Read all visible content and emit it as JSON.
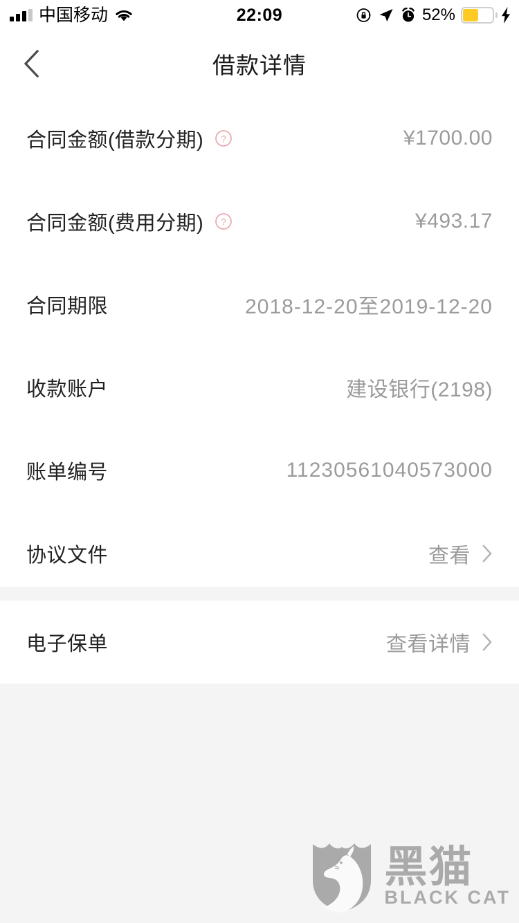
{
  "status_bar": {
    "carrier": "中国移动",
    "time": "22:09",
    "battery_percent": "52%",
    "icons": [
      "signal-bars-icon",
      "wifi-icon",
      "rotation-lock-icon",
      "location-arrow-icon",
      "alarm-clock-icon",
      "battery-icon",
      "charging-bolt-icon"
    ]
  },
  "nav": {
    "back_icon": "chevron-left-icon",
    "title": "借款详情"
  },
  "sections": [
    {
      "rows": [
        {
          "label": "合同金额(借款分期)",
          "help": true,
          "value": "¥1700.00",
          "chevron": false
        },
        {
          "label": "合同金额(费用分期)",
          "help": true,
          "value": "¥493.17",
          "chevron": false
        },
        {
          "label": "合同期限",
          "help": false,
          "value": "2018-12-20至2019-12-20",
          "chevron": false
        },
        {
          "label": "收款账户",
          "help": false,
          "value": "建设银行(2198)",
          "chevron": false
        },
        {
          "label": "账单编号",
          "help": false,
          "value": "11230561040573000",
          "chevron": false
        },
        {
          "label": "协议文件",
          "help": false,
          "value": "查看",
          "chevron": true
        }
      ]
    },
    {
      "rows": [
        {
          "label": "电子保单",
          "help": false,
          "value": "查看详情",
          "chevron": true
        }
      ]
    }
  ],
  "watermark": {
    "cn": "黑猫",
    "en": "BLACK CAT",
    "icon": "black-cat-shield-logo"
  },
  "colors": {
    "page_bg": "#f4f4f5",
    "card_bg": "#ffffff",
    "label": "#222222",
    "value": "#9b9b9b",
    "help_icon": "#e8a7ad",
    "battery_fill": "#fdcb24"
  }
}
